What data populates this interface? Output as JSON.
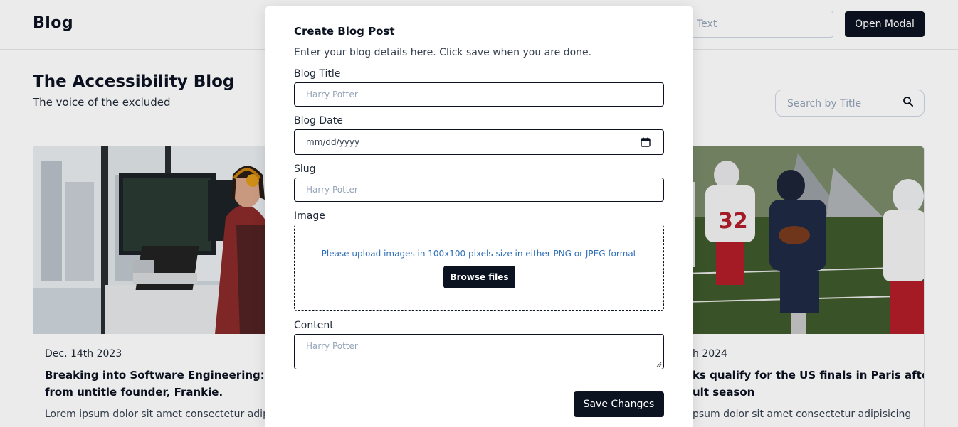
{
  "navbar": {
    "brand": "Blog",
    "input_placeholder": "Text",
    "open_modal_label": "Open Modal"
  },
  "hero": {
    "title": "The Accessibility Blog",
    "subtitle": "The voice of the excluded"
  },
  "search": {
    "placeholder": "Search by Title",
    "icon": "search-icon"
  },
  "cards": [
    {
      "date": "Dec. 14th 2023",
      "title": "Breaking into Software Engineering: Adv",
      "title_line2": "from untitle founder, Frankie.",
      "excerpt": "Lorem ipsum dolor sit amet consectetur adipis",
      "image": "person-coding-at-desk"
    },
    {
      "date": "h 2024",
      "title": "ks qualify for the US finals in Paris after",
      "title_line2": "ult season",
      "excerpt": "psum dolor sit amet consectetur adipisicing",
      "image": "american-football-game"
    }
  ],
  "modal": {
    "title": "Create Blog Post",
    "description": "Enter your blog details here. Click save when you are done.",
    "fields": {
      "blog_title": {
        "label": "Blog Title",
        "placeholder": "Harry Potter"
      },
      "blog_date": {
        "label": "Blog Date",
        "placeholder": "mm/dd/yyyy"
      },
      "slug": {
        "label": "Slug",
        "placeholder": "Harry Potter"
      },
      "image": {
        "label": "Image",
        "hint": "Please upload images in 100x100 pixels size in either PNG or JPEG format",
        "browse_label": "Browse files"
      },
      "content": {
        "label": "Content",
        "placeholder": "Harry Potter"
      }
    },
    "save_label": "Save Changes"
  },
  "colors": {
    "primary": "#0b1220",
    "hint_blue": "#2f6fb8",
    "placeholder": "#94a3b8"
  }
}
